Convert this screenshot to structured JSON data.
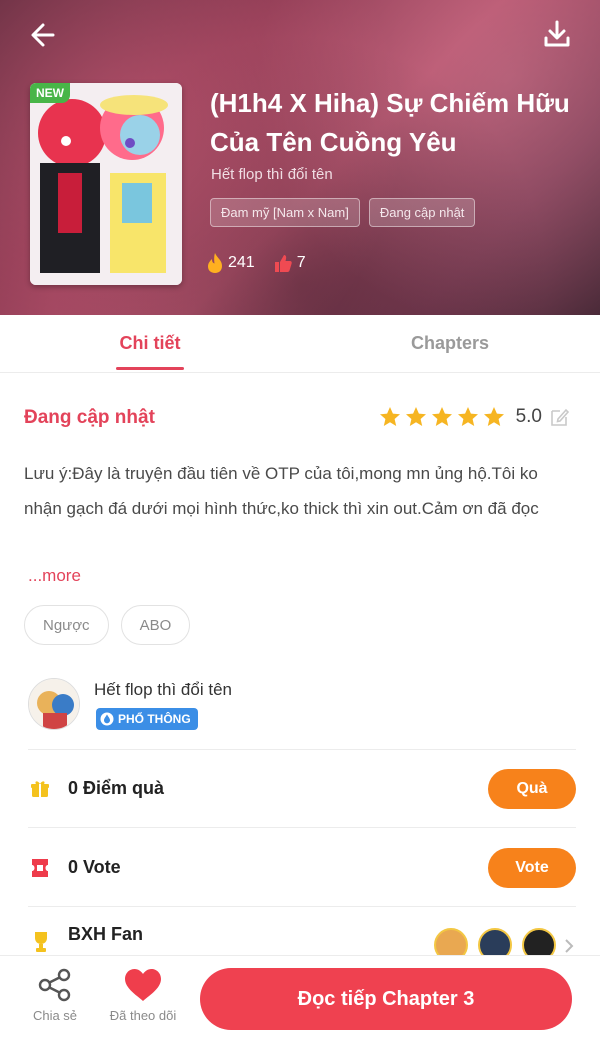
{
  "header": {
    "new_badge": "NEW",
    "title": "(H1h4 X Hiha) Sự Chiếm Hữu Của Tên Cuồng Yêu",
    "author": "Hết flop thì đổi tên",
    "tags": [
      "Đam mỹ [Nam x Nam]",
      "Đang cập nhật"
    ],
    "stats": {
      "views": "241",
      "likes": "7"
    },
    "icons": {
      "back": "arrow-left-icon",
      "download": "download-icon"
    }
  },
  "tabs": [
    {
      "label": "Chi tiết",
      "active": true
    },
    {
      "label": "Chapters",
      "active": false
    }
  ],
  "detail": {
    "status": "Đang cập nhật",
    "rating": "5.0",
    "stars": 5,
    "description": "Lưu ý:Đây là truyện đầu tiên về OTP của tôi,mong mn ủng hộ.Tôi ko nhận gạch đá dưới mọi hình thức,ko thick thì xin out.Cảm ơn đã đọc",
    "more": "...more",
    "genres": [
      "Ngược",
      "ABO"
    ]
  },
  "author_block": {
    "name": "Hết flop thì đổi tên",
    "level": "PHỔ THÔNG"
  },
  "gift_row": {
    "label": "0 Điểm quà",
    "button": "Quà"
  },
  "vote_row": {
    "label": "0 Vote",
    "button": "Vote"
  },
  "fan_row": {
    "label": "BXH Fan"
  },
  "bottom_bar": {
    "share": "Chia sẻ",
    "follow": "Đã theo dõi",
    "read": "Đọc tiếp Chapter 3"
  },
  "colors": {
    "accent": "#e3435a",
    "button_orange": "#f7821b",
    "read_button": "#ef4150",
    "level_badge": "#3b8ee6"
  }
}
